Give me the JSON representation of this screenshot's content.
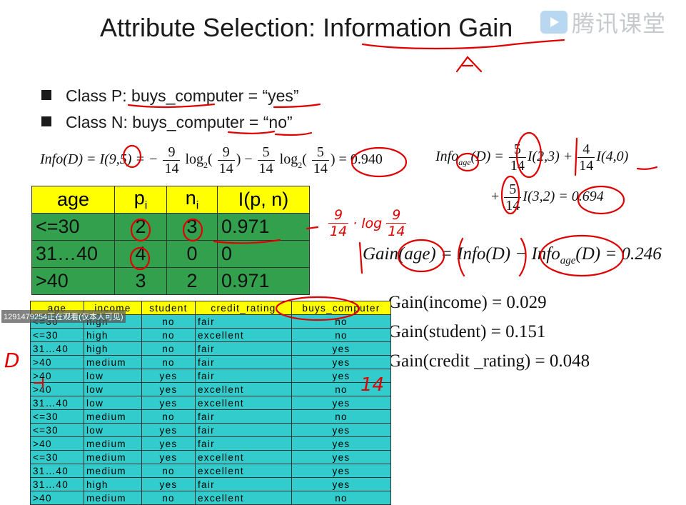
{
  "title": "Attribute Selection: Information Gain",
  "watermark": "腾讯课堂",
  "bullets": [
    {
      "label": "Class P: buys_computer = “yes”"
    },
    {
      "label": "Class N: buys_computer = “no”"
    }
  ],
  "info_formula": {
    "lhs": "Info(D) = I(9,5) = −",
    "f1_num": "9",
    "f1_den": "14",
    "log1": "log",
    "base": "2",
    "f2_num": "9",
    "f2_den": "14",
    "minus": ") −",
    "f3_num": "5",
    "f3_den": "14",
    "log2": "log",
    "f4_num": "5",
    "f4_den": "14",
    "result": ") = 0.940"
  },
  "info_age": {
    "lhs_a": "Info",
    "lhs_sub": "age",
    "lhs_b": "(D) =",
    "t1_num": "5",
    "t1_den": "14",
    "t1_rest": "I(2,3) +",
    "t2_num": "4",
    "t2_den": "14",
    "t2_rest": "I(4,0)",
    "plus": "+",
    "t3_num": "5",
    "t3_den": "14",
    "t3_rest": "I(3,2) = 0.694"
  },
  "age_table": {
    "headers": [
      "age",
      "p",
      "n",
      "I(p, n)"
    ],
    "header_subs": [
      "",
      "i",
      "i",
      ""
    ],
    "rows": [
      [
        "<=30",
        "2",
        "3",
        "0.971"
      ],
      [
        "31…40",
        "4",
        "0",
        "0"
      ],
      [
        ">40",
        "3",
        "2",
        "0.971"
      ]
    ]
  },
  "gain_age": {
    "a": "Gain(age) = Info(D) − Info",
    "sub": "age",
    "b": "(D) = 0.246"
  },
  "gains": [
    "Gain(income) = 0.029",
    "Gain(student) = 0.151",
    "Gain(credit _rating) = 0.048"
  ],
  "data_table": {
    "headers": [
      "age",
      "income",
      "student",
      "credit_rating",
      "buys_computer"
    ],
    "rows": [
      [
        "<=30",
        "high",
        "no",
        "fair",
        "no"
      ],
      [
        "<=30",
        "high",
        "no",
        "excellent",
        "no"
      ],
      [
        "31…40",
        "high",
        "no",
        "fair",
        "yes"
      ],
      [
        ">40",
        "medium",
        "no",
        "fair",
        "yes"
      ],
      [
        ">40",
        "low",
        "yes",
        "fair",
        "yes"
      ],
      [
        ">40",
        "low",
        "yes",
        "excellent",
        "no"
      ],
      [
        "31…40",
        "low",
        "yes",
        "excellent",
        "yes"
      ],
      [
        "<=30",
        "medium",
        "no",
        "fair",
        "no"
      ],
      [
        "<=30",
        "low",
        "yes",
        "fair",
        "yes"
      ],
      [
        ">40",
        "medium",
        "yes",
        "fair",
        "yes"
      ],
      [
        "<=30",
        "medium",
        "yes",
        "excellent",
        "yes"
      ],
      [
        "31…40",
        "medium",
        "no",
        "excellent",
        "yes"
      ],
      [
        "31…40",
        "high",
        "yes",
        "fair",
        "yes"
      ],
      [
        ">40",
        "medium",
        "no",
        "excellent",
        "no"
      ]
    ]
  },
  "viewer_overlay": "1291479254正在观看(仅本人可见)",
  "annotations": {
    "d_label": "D",
    "count_label": "14",
    "frac_num": "9",
    "frac_den": "14",
    "log_text": "· log",
    "log_num": "9",
    "log_den": "14"
  },
  "colors": {
    "header_yellow": "#ffff00",
    "age_table_green": "#33a04e",
    "data_table_cyan": "#33cccc",
    "ink_red": "#e00000"
  }
}
